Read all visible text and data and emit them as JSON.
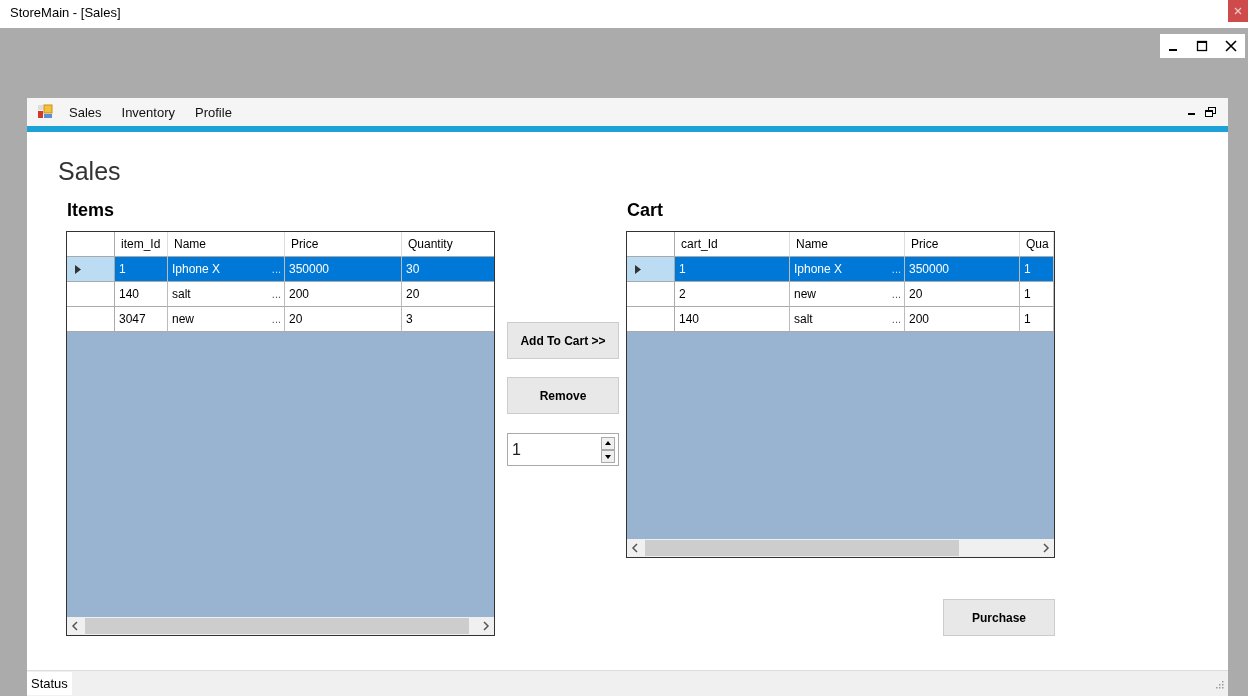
{
  "window": {
    "title": "StoreMain - [Sales]"
  },
  "menu": {
    "items": [
      {
        "label": "Sales"
      },
      {
        "label": "Inventory"
      },
      {
        "label": "Profile"
      }
    ]
  },
  "page": {
    "title": "Sales"
  },
  "items": {
    "title": "Items",
    "columns": [
      "item_Id",
      "Name",
      "Price",
      "Quantity"
    ],
    "rows": [
      {
        "selected": true,
        "cells": [
          "1",
          "Iphone X",
          "350000",
          "30"
        ],
        "name_button": "..."
      },
      {
        "selected": false,
        "cells": [
          "140",
          "salt",
          "200",
          "20"
        ],
        "name_button": "..."
      },
      {
        "selected": false,
        "cells": [
          "3047",
          "new",
          "20",
          "3"
        ],
        "name_button": "..."
      }
    ]
  },
  "actions": {
    "add_button": "Add To Cart >>",
    "remove_button": "Remove",
    "quantity": "1"
  },
  "cart": {
    "title": "Cart",
    "columns": [
      "cart_Id",
      "Name",
      "Price",
      "Qua"
    ],
    "rows": [
      {
        "selected": true,
        "cells": [
          "1",
          "Iphone X",
          "350000",
          "1"
        ],
        "name_button": "..."
      },
      {
        "selected": false,
        "cells": [
          "2",
          "new",
          "20",
          "1"
        ],
        "name_button": "..."
      },
      {
        "selected": false,
        "cells": [
          "140",
          "salt",
          "200",
          "1"
        ],
        "name_button": "..."
      }
    ]
  },
  "purchase_button": "Purchase",
  "status_bar": {
    "text": "Status"
  }
}
